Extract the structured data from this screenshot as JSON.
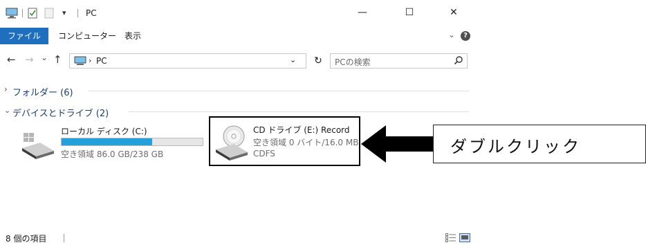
{
  "window": {
    "title": "PC",
    "controls": {
      "minimize": "—",
      "maximize": "☐",
      "close": "✕"
    }
  },
  "ribbon": {
    "tabs": [
      {
        "label": "ファイル"
      },
      {
        "label": "コンピューター"
      },
      {
        "label": "表示"
      }
    ],
    "help": "?"
  },
  "address_bar": {
    "back": "←",
    "forward": "→",
    "recent": "⌄",
    "up": "↑",
    "path": "PC",
    "refresh": "↻",
    "search_placeholder": "PCの検索"
  },
  "groups": [
    {
      "label": "フォルダー (6)",
      "expanded": false
    },
    {
      "label": "デバイスとドライブ (2)",
      "expanded": true
    }
  ],
  "drives": [
    {
      "name": "ローカル ディスク (C:)",
      "free": "空き領域 86.0 GB/238 GB",
      "used_fraction": 0.64
    },
    {
      "name": "CD ドライブ (E:) Record",
      "free": "空き領域 0 バイト/16.0 MB",
      "filesystem": "CDFS"
    }
  ],
  "status_bar": {
    "count": "8 個の項目"
  },
  "annotation": {
    "text": "ダブルクリック"
  },
  "colors": {
    "file_tab": "#1e6fbe",
    "usage_bar": "#26a0da"
  }
}
